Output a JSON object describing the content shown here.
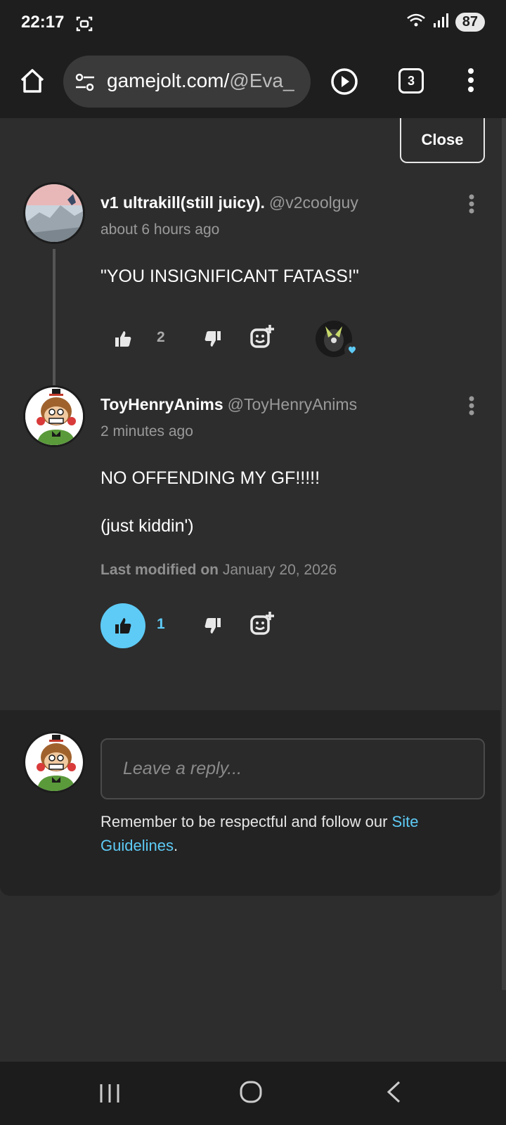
{
  "status_bar": {
    "time": "22:17",
    "battery": "87",
    "icons": [
      "screenshot-icon",
      "wifi-icon",
      "signal-icon"
    ]
  },
  "browser": {
    "url_main": "gamejolt.com/",
    "url_rest": "@Eva_",
    "tab_count": "3",
    "icons": [
      "home-icon",
      "tune-icon",
      "play-icon",
      "more-icon"
    ]
  },
  "close_label": "Close",
  "comments": [
    {
      "name": "v1 ultrakill(still juicy).",
      "handle": "@v2coolguy",
      "time": "about 6 hours ago",
      "body": "\"YOU INSIGNIFICANT FATASS!\"",
      "likes": "2",
      "liked": false
    },
    {
      "name": "ToyHenryAnims",
      "handle": "@ToyHenryAnims",
      "time": "2 minutes ago",
      "body_lines": [
        "NO OFFENDING MY GF!!!!!",
        "(just kiddin')"
      ],
      "modified_label": "Last modified on",
      "modified_date": "January 20, 2026",
      "likes": "1",
      "liked": true
    }
  ],
  "reply": {
    "placeholder": "Leave a reply...",
    "note_prefix": "Remember to be respectful and follow our ",
    "note_link": "Site Guidelines",
    "note_suffix": "."
  },
  "colors": {
    "accent": "#5ecbf6",
    "background": "#2d2d2d",
    "panel": "#232323"
  }
}
